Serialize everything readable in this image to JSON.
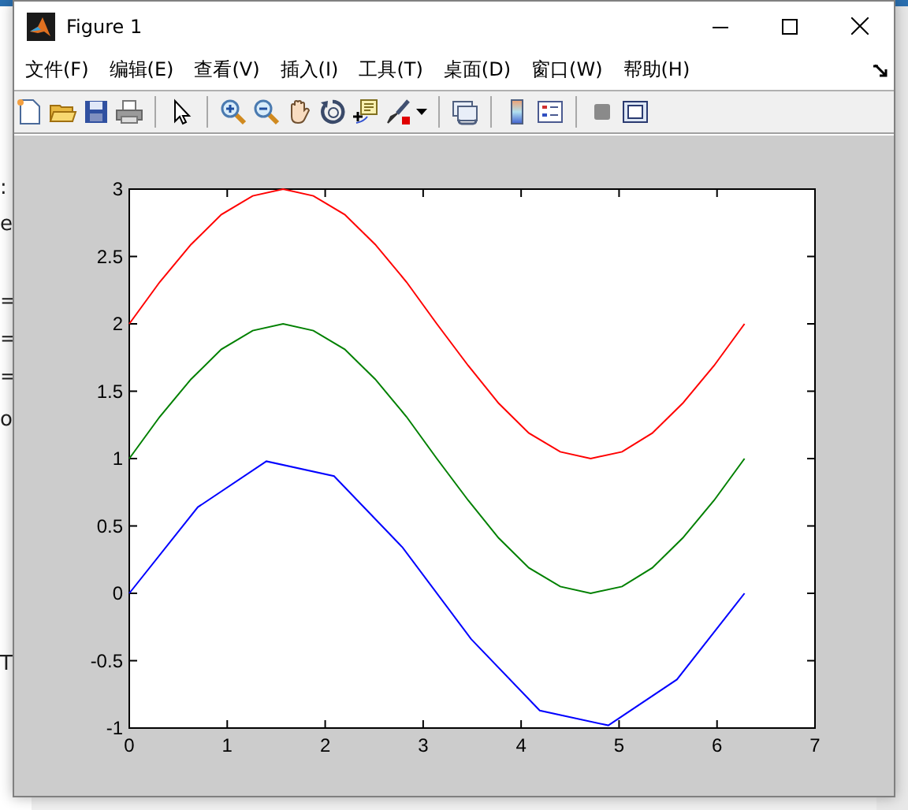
{
  "background_window": {
    "fragments": [
      ":",
      "e",
      "=",
      "=",
      "=",
      "o",
      "T"
    ]
  },
  "window": {
    "title": "Figure 1"
  },
  "menu": [
    "文件(F)",
    "编辑(E)",
    "查看(V)",
    "插入(I)",
    "工具(T)",
    "桌面(D)",
    "窗口(W)",
    "帮助(H)"
  ],
  "toolbar": [
    {
      "kind": "new"
    },
    {
      "kind": "open"
    },
    {
      "kind": "save"
    },
    {
      "kind": "print"
    },
    {
      "kind": "sep"
    },
    {
      "kind": "pointer"
    },
    {
      "kind": "sep"
    },
    {
      "kind": "zoom-in"
    },
    {
      "kind": "zoom-out"
    },
    {
      "kind": "pan"
    },
    {
      "kind": "rotate"
    },
    {
      "kind": "datatip"
    },
    {
      "kind": "brush"
    },
    {
      "kind": "dropdown"
    },
    {
      "kind": "sep"
    },
    {
      "kind": "link"
    },
    {
      "kind": "sep"
    },
    {
      "kind": "colorbar"
    },
    {
      "kind": "legend"
    },
    {
      "kind": "sep"
    },
    {
      "kind": "hide"
    },
    {
      "kind": "plottools"
    }
  ],
  "chart_data": {
    "type": "line",
    "xlim": [
      0,
      7
    ],
    "ylim": [
      -1,
      3
    ],
    "xticks": [
      0,
      1,
      2,
      3,
      4,
      5,
      6,
      7
    ],
    "yticks": [
      -1,
      -0.5,
      0,
      0.5,
      1,
      1.5,
      2,
      2.5,
      3
    ],
    "series": [
      {
        "color": "#ff0000",
        "x": [
          0,
          0.31,
          0.63,
          0.94,
          1.26,
          1.57,
          1.88,
          2.2,
          2.51,
          2.83,
          3.14,
          3.46,
          3.77,
          4.08,
          4.4,
          4.71,
          5.03,
          5.34,
          5.65,
          5.97,
          6.28
        ],
        "values": [
          2,
          2.31,
          2.59,
          2.81,
          2.95,
          3,
          2.95,
          2.81,
          2.59,
          2.31,
          2,
          1.69,
          1.41,
          1.19,
          1.05,
          1,
          1.05,
          1.19,
          1.41,
          1.69,
          2
        ]
      },
      {
        "color": "#008000",
        "x": [
          0,
          0.31,
          0.63,
          0.94,
          1.26,
          1.57,
          1.88,
          2.2,
          2.51,
          2.83,
          3.14,
          3.46,
          3.77,
          4.08,
          4.4,
          4.71,
          5.03,
          5.34,
          5.65,
          5.97,
          6.28
        ],
        "values": [
          1,
          1.31,
          1.59,
          1.81,
          1.95,
          2,
          1.95,
          1.81,
          1.59,
          1.31,
          1,
          0.69,
          0.41,
          0.19,
          0.05,
          0,
          0.05,
          0.19,
          0.41,
          0.69,
          1
        ]
      },
      {
        "color": "#0000ff",
        "x": [
          0,
          0.7,
          1.4,
          2.09,
          2.79,
          3.49,
          4.19,
          4.89,
          5.59,
          6.28
        ],
        "values": [
          0,
          0.64,
          0.98,
          0.87,
          0.34,
          -0.34,
          -0.87,
          -0.98,
          -0.64,
          0
        ]
      }
    ]
  }
}
